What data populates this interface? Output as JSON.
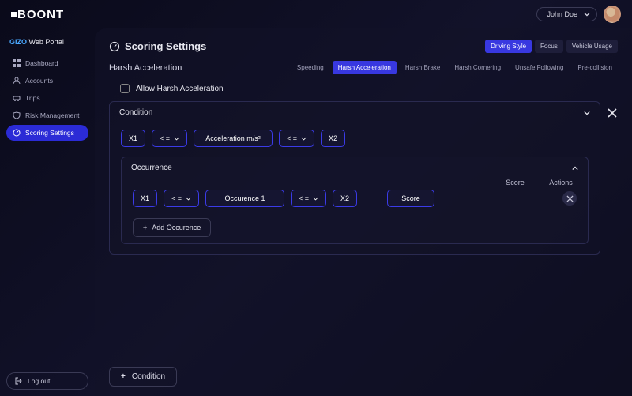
{
  "user": {
    "name": "John Doe"
  },
  "portal": {
    "brand": "GIZO",
    "label": "Web Portal"
  },
  "nav": {
    "items": [
      {
        "label": "Dashboard"
      },
      {
        "label": "Accounts"
      },
      {
        "label": "Trips"
      },
      {
        "label": "Risk Management"
      },
      {
        "label": "Scoring Settings"
      }
    ],
    "logout": "Log out"
  },
  "page": {
    "title": "Scoring Settings",
    "tabs": [
      {
        "label": "Driving Style",
        "active": true
      },
      {
        "label": "Focus"
      },
      {
        "label": "Vehicle Usage"
      }
    ],
    "section_title": "Harsh Acceleration",
    "subtabs": [
      {
        "label": "Speeding"
      },
      {
        "label": "Harsh Acceleration",
        "active": true
      },
      {
        "label": "Harsh Brake"
      },
      {
        "label": "Harsh Cornering"
      },
      {
        "label": "Unsafe Following"
      },
      {
        "label": "Pre-collision"
      }
    ],
    "allow_label": "Allow Harsh Acceleration"
  },
  "condition": {
    "title": "Condition",
    "x1": "X1",
    "op1": "< =",
    "field": "Acceleration m/s²",
    "op2": "< =",
    "x2": "X2"
  },
  "occurrence": {
    "title": "Occurrence",
    "columns": {
      "score": "Score",
      "actions": "Actions"
    },
    "row": {
      "x1": "X1",
      "op1": "< =",
      "field": "Occurence 1",
      "op2": "< =",
      "x2": "X2",
      "score": "Score"
    },
    "add_label": "Add Occurence"
  },
  "add_condition": "Condition"
}
